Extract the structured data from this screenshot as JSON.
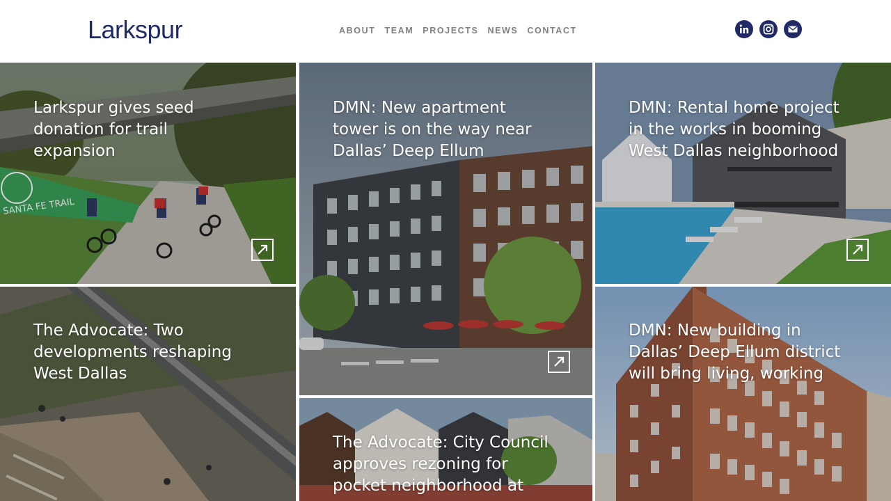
{
  "brand": {
    "name": "Larkspur",
    "color": "#1f2a66"
  },
  "nav": [
    {
      "label": "ABOUT"
    },
    {
      "label": "TEAM"
    },
    {
      "label": "PROJECTS"
    },
    {
      "label": "NEWS"
    },
    {
      "label": "CONTACT"
    }
  ],
  "social": [
    {
      "icon": "linkedin-icon"
    },
    {
      "icon": "instagram-icon"
    },
    {
      "icon": "mail-icon"
    }
  ],
  "tiles": [
    {
      "title": "Larkspur gives seed donation for trail expansion",
      "has_arrow": true,
      "sign_text": "SANTA FE TRAIL"
    },
    {
      "title": "DMN: New apartment tower is on the way near Dallas’ Deep Ellum",
      "has_arrow": true
    },
    {
      "title": "DMN: Rental home project in the works in booming West Dallas neighborhood",
      "has_arrow": true
    },
    {
      "title": "The Advocate: Two developments reshaping West Dallas",
      "has_arrow": false
    },
    {
      "title": "The Advocate: City Council approves rezoning for pocket neighborhood at",
      "has_arrow": false
    },
    {
      "title": "DMN: New building in Dallas’ Deep Ellum district will bring living, working",
      "has_arrow": false
    }
  ]
}
